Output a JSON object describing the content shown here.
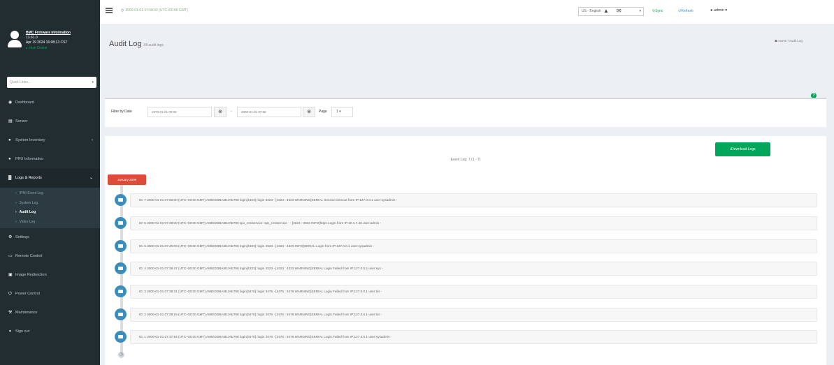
{
  "colors": {
    "sidebar": "#222d32",
    "primary": "#3c8dbc",
    "success": "#00a65a",
    "danger": "#dd4b39"
  },
  "user_panel": {
    "firmware_link": "BMC Firmware Information",
    "version": "13.61.0",
    "build_date": "Apr 19 2024 16:08:13 CST",
    "status": "Host Online"
  },
  "quick_links": {
    "placeholder": "Quick Links..."
  },
  "sidebar": {
    "items": [
      {
        "icon": "dashboard-icon",
        "glyph": "◉",
        "label": "Dashboard"
      },
      {
        "icon": "server-icon",
        "glyph": "▤",
        "label": "Sensor"
      },
      {
        "icon": "info-icon",
        "glyph": "●",
        "label": "System Inventory"
      },
      {
        "icon": "info-icon",
        "glyph": "●",
        "label": "FRU Information"
      },
      {
        "icon": "chart-icon",
        "glyph": "▓",
        "label": "Logs & Reports"
      },
      {
        "icon": "gear-icon",
        "glyph": "⚙",
        "label": "Settings"
      },
      {
        "icon": "monitor-icon",
        "glyph": "▭",
        "label": "Remote Control"
      },
      {
        "icon": "media-icon",
        "glyph": "▣",
        "label": "Image Redirection"
      },
      {
        "icon": "power-icon",
        "glyph": "⏻",
        "label": "Power Control"
      },
      {
        "icon": "wrench-icon",
        "glyph": "⚒",
        "label": "Maintenance"
      },
      {
        "icon": "sign-out-icon",
        "glyph": "➧",
        "label": "Sign out"
      }
    ],
    "sub_items": [
      "IPMI Event Log",
      "System Log",
      "Audit Log",
      "Video Log"
    ]
  },
  "topbar": {
    "datetime": "2000-01-01 07:58:02 (UTC+00:00 GMT)",
    "language": "US - English",
    "sync": "Sync",
    "refresh": "Refresh",
    "user": "admin"
  },
  "header": {
    "title": "Audit Log",
    "subtitle": "All audit logs",
    "breadcrumb_home": "Home",
    "breadcrumb_current": "Audit Log"
  },
  "filter": {
    "label": "Filter by Date",
    "start": "1970-01-01 00:00",
    "end": "2000-01-01 07:58",
    "page_label": "Page",
    "page": "1"
  },
  "log": {
    "download_label": "Download Logs",
    "event_count": "Event Log: 7 (1 - 7)",
    "time_label": "January 2000",
    "entries": [
      "ID: 7 2000-01-01 07:50:00 (UTC+00:00 GMT)   AMIEDDBA5EJAE790   login[4323]: login 4323 - [4323 : 4323 WARNING]SERIAL Session timeout from IP:127.0.0.1 user:sysadmin -",
      "ID: 6 2000-01-01 07:48:00 (UTC+00:00 GMT)   AMIEDDBA5EJAE790   spx_restservice: spx_restservice - - [3024 : 3024 INFO]https Login from IP:10.1.7.48 user:admin -",
      "ID: 5 2000-01-01 07:40:03 (UTC+00:00 GMT)   AMIEDDBA5EJAE790   login[4323]: login 4323 - [4323 : 4323 INFO]SERIAL Login from IP:127.0.0.1 user:sysadmin -",
      "ID: 4 2000-01-01 07:39:47 (UTC+00:00 GMT)   AMIEDDBA5EJAE790   login[4323]: login 4323 - [4323 : 4323 WARNING]SERIAL Login Failed from IP:127.0.0.1 user:sys -",
      "ID: 3 2000-01-01 07:38:31 (UTC+00:00 GMT)   AMIEDDBA5EJAE790   login[3476]: login 3476 - [3476 : 3476 WARNING]SERIAL Login Failed from IP:127.0.0.1 user:sis -",
      "ID: 2 2000-01-01 07:38:15 (UTC+00:00 GMT)   AMIEDDBA5EJAE790   login[3476]: login 3476 - [3476 : 3476 WARNING]SERIAL Login Failed from IP:127.0.0.1 user:sis -",
      "ID: 1 2000-01-01 07:37:54 (UTC+00:00 GMT)   AMIEDDBA5EJAE790   login[3476]: login 3476 - [3476 : 3476 WARNING]SERIAL Login Failed from IP:127.0.0.1 user:sysadmin -"
    ]
  }
}
